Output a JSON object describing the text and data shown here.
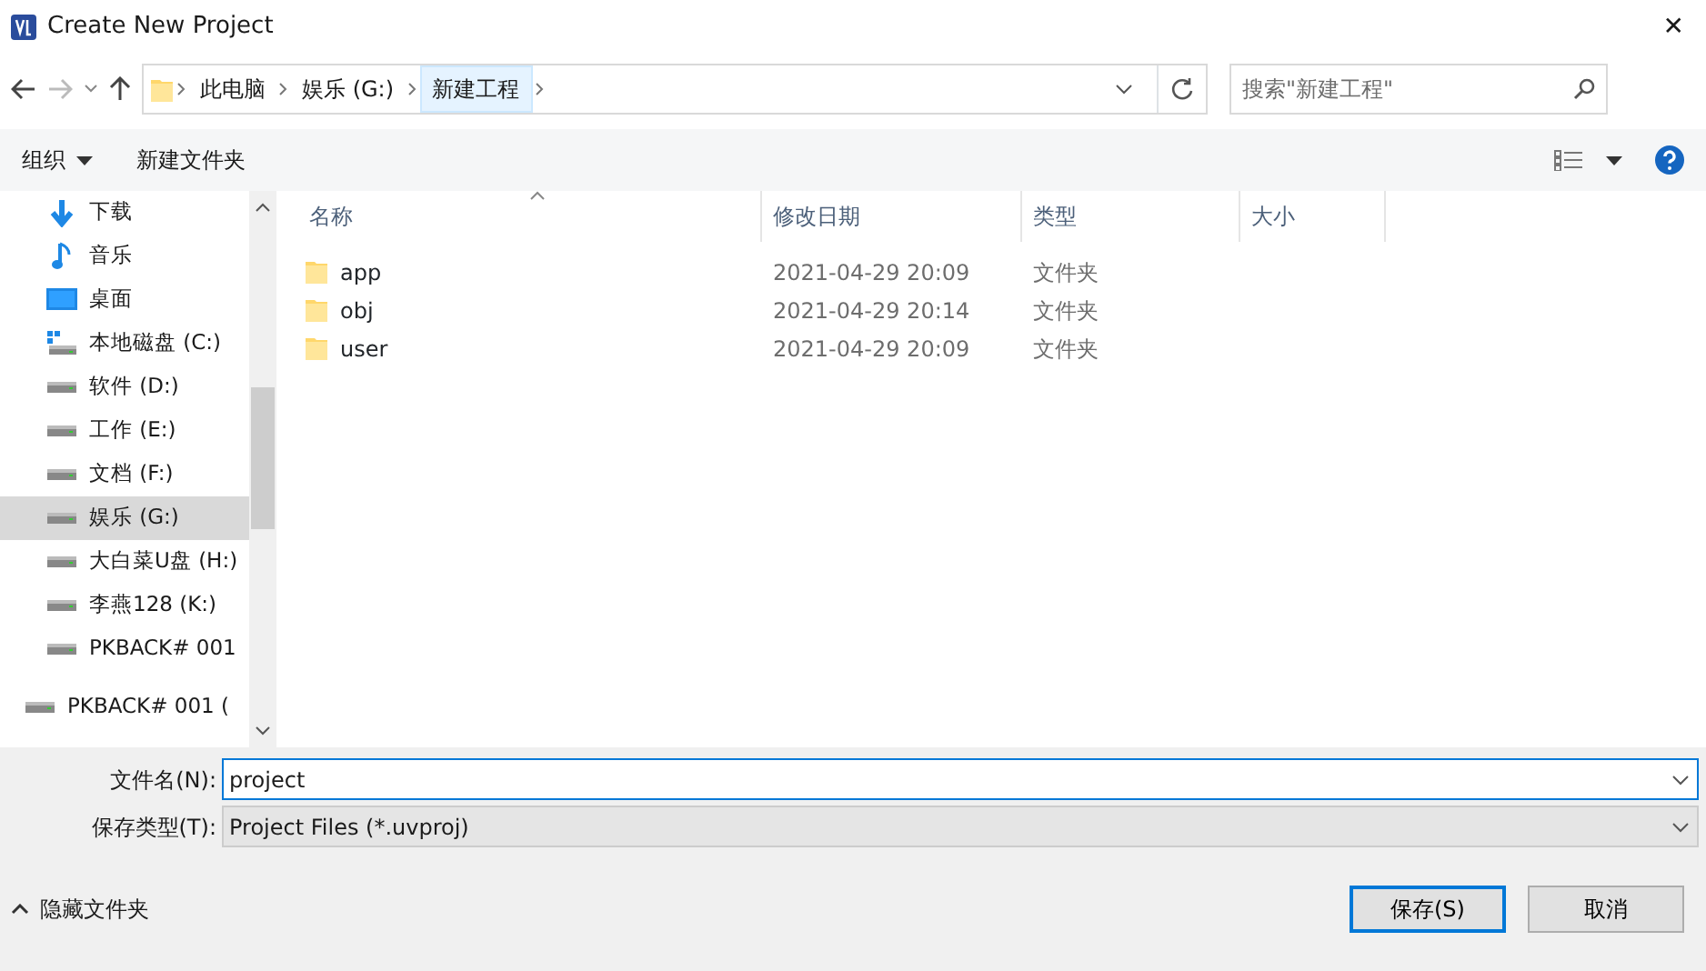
{
  "window": {
    "title": "Create New Project",
    "close": "✕"
  },
  "address": {
    "crumbs": [
      {
        "label": "此电脑",
        "selected": false
      },
      {
        "label": "娱乐 (G:)",
        "selected": false
      },
      {
        "label": "新建工程",
        "selected": true
      }
    ]
  },
  "search": {
    "placeholder": "搜索\"新建工程\""
  },
  "toolbar": {
    "organize": "组织",
    "new_folder": "新建文件夹"
  },
  "sidebar": {
    "nested_items": [
      {
        "label": "下载",
        "kind": "download",
        "selected": false
      },
      {
        "label": "音乐",
        "kind": "music",
        "selected": false
      },
      {
        "label": "桌面",
        "kind": "desktop",
        "selected": false
      },
      {
        "label": "本地磁盘 (C:)",
        "kind": "system-drive",
        "selected": false
      },
      {
        "label": "软件 (D:)",
        "kind": "drive",
        "selected": false
      },
      {
        "label": "工作 (E:)",
        "kind": "drive",
        "selected": false
      },
      {
        "label": "文档 (F:)",
        "kind": "drive",
        "selected": false
      },
      {
        "label": "娱乐 (G:)",
        "kind": "drive",
        "selected": true
      },
      {
        "label": "大白菜U盘 (H:)",
        "kind": "drive",
        "selected": false
      },
      {
        "label": "李燕128 (K:)",
        "kind": "drive",
        "selected": false
      },
      {
        "label": "PKBACK# 001",
        "kind": "drive",
        "selected": false
      }
    ],
    "items": [
      {
        "label": "PKBACK# 001 (",
        "kind": "drive",
        "selected": false
      }
    ]
  },
  "table": {
    "columns": [
      "名称",
      "修改日期",
      "类型",
      "大小"
    ],
    "rows": [
      {
        "name": "app",
        "modified": "2021-04-29 20:09",
        "type": "文件夹"
      },
      {
        "name": "obj",
        "modified": "2021-04-29 20:14",
        "type": "文件夹"
      },
      {
        "name": "user",
        "modified": "2021-04-29 20:09",
        "type": "文件夹"
      }
    ]
  },
  "form": {
    "filename_label": "文件名(N):",
    "filename": "project",
    "filetype_label": "保存类型(T):",
    "filetype": "Project Files (*.uvproj)"
  },
  "footer": {
    "hide_folders": "隐藏文件夹",
    "buttons": [
      {
        "label": "保存(S)",
        "kind": "primary"
      },
      {
        "label": "取消",
        "kind": "secondary"
      }
    ]
  }
}
